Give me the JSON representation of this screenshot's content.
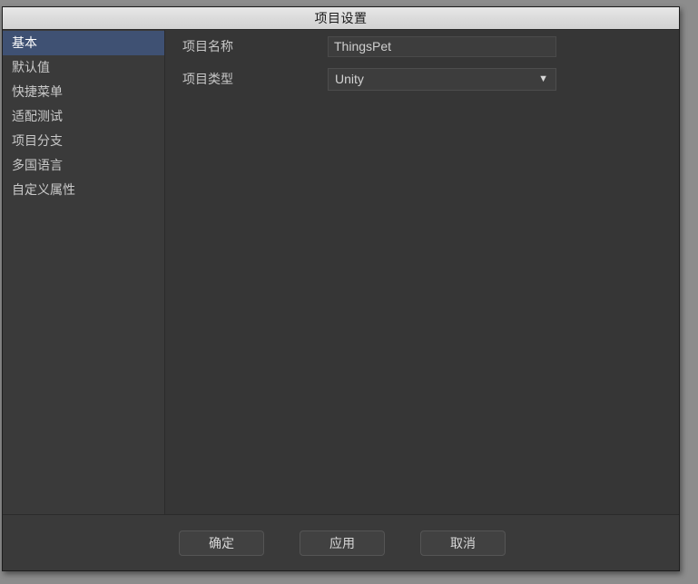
{
  "window": {
    "title": "项目设置"
  },
  "sidebar": {
    "items": [
      {
        "label": "基本",
        "selected": true
      },
      {
        "label": "默认值",
        "selected": false
      },
      {
        "label": "快捷菜单",
        "selected": false
      },
      {
        "label": "适配测试",
        "selected": false
      },
      {
        "label": "项目分支",
        "selected": false
      },
      {
        "label": "多国语言",
        "selected": false
      },
      {
        "label": "自定义属性",
        "selected": false
      }
    ]
  },
  "form": {
    "project_name": {
      "label": "项目名称",
      "value": "ThingsPet",
      "placeholder": ""
    },
    "project_type": {
      "label": "项目类型",
      "value": "Unity",
      "arrow_glyph": "▼"
    }
  },
  "footer": {
    "ok_label": "确定",
    "apply_label": "应用",
    "cancel_label": "取消"
  },
  "colors": {
    "titlebar": "#dadada",
    "dialog_bg": "#3a3a3a",
    "content_bg": "#363636",
    "selection": "#3f5173",
    "text": "#c9c9c9"
  }
}
